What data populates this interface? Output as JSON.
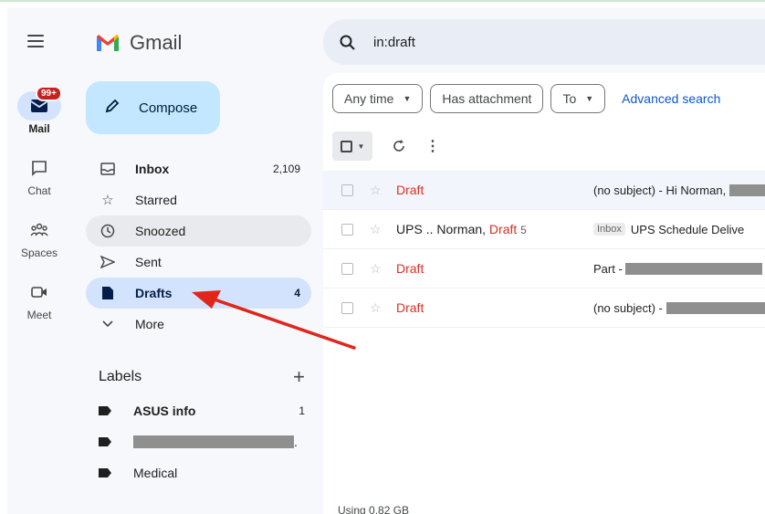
{
  "app": {
    "name": "Gmail"
  },
  "rail": {
    "items": [
      {
        "label": "Mail",
        "icon": "mail-icon",
        "badge": "99+"
      },
      {
        "label": "Chat",
        "icon": "chat-icon"
      },
      {
        "label": "Spaces",
        "icon": "spaces-icon"
      },
      {
        "label": "Meet",
        "icon": "meet-icon"
      }
    ]
  },
  "compose": {
    "label": "Compose"
  },
  "nav": {
    "items": [
      {
        "label": "Inbox",
        "count": "2,109",
        "icon": "inbox-icon"
      },
      {
        "label": "Starred",
        "icon": "star-icon"
      },
      {
        "label": "Snoozed",
        "icon": "clock-icon"
      },
      {
        "label": "Sent",
        "icon": "send-icon"
      },
      {
        "label": "Drafts",
        "count": "4",
        "icon": "draft-icon"
      },
      {
        "label": "More",
        "icon": "chevron-down-icon"
      }
    ]
  },
  "labels": {
    "heading": "Labels",
    "add": "+",
    "items": [
      {
        "label": "ASUS info",
        "count": "1"
      },
      {
        "label": "",
        "suffix": ".",
        "redacted": true
      },
      {
        "label": "Medical"
      }
    ]
  },
  "search": {
    "query": "in:draft"
  },
  "filters": {
    "chips": [
      "Any time",
      "Has attachment",
      "To"
    ],
    "advanced": "Advanced search"
  },
  "emails": [
    {
      "sender": "Draft",
      "subject": "(no subject) - Hi Norman,",
      "redacted": true
    },
    {
      "sender_prefix": "UPS .. Norman, ",
      "sender_draft": "Draft",
      "count": "5",
      "tag": "Inbox",
      "subject": "UPS Schedule Delive"
    },
    {
      "sender": "Draft",
      "subject": "Part -",
      "redacted": true
    },
    {
      "sender": "Draft",
      "subject": "(no subject) -",
      "redacted": true
    }
  ],
  "storage": "Using 0.82 GB",
  "colors": {
    "accent": "#0b57d0",
    "compose": "#c2e7ff",
    "selected": "#d3e3fd",
    "draft": "#d93025",
    "annotation_arrow": "#e0251b"
  }
}
